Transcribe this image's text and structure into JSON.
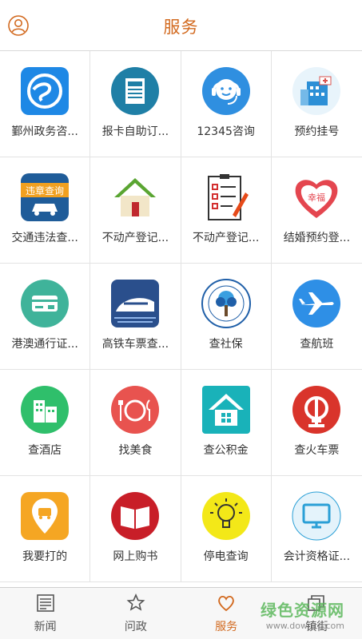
{
  "header": {
    "title": "服务",
    "profile_icon": "user-profile-icon",
    "accent": "#d2691e"
  },
  "grid": [
    [
      {
        "label": "鄞州政务咨...",
        "icon": "yinzhou-government-icon"
      },
      {
        "label": "报卡自助订...",
        "icon": "newspaper-icon"
      },
      {
        "label": "12345咨询",
        "icon": "customer-service-icon"
      },
      {
        "label": "预约挂号",
        "icon": "hospital-icon"
      }
    ],
    [
      {
        "label": "交通违法查...",
        "icon": "traffic-violation-icon",
        "badge": "违章查询"
      },
      {
        "label": "不动产登记...",
        "icon": "house-icon"
      },
      {
        "label": "不动产登记...",
        "icon": "checklist-icon"
      },
      {
        "label": "结婚预约登...",
        "icon": "wedding-heart-icon",
        "badge": "幸福"
      }
    ],
    [
      {
        "label": "港澳通行证...",
        "icon": "travel-permit-card-icon"
      },
      {
        "label": "高铁车票查...",
        "icon": "high-speed-train-icon"
      },
      {
        "label": "查社保",
        "icon": "social-security-icon"
      },
      {
        "label": "查航班",
        "icon": "airplane-icon"
      }
    ],
    [
      {
        "label": "查酒店",
        "icon": "hotel-icon"
      },
      {
        "label": "找美食",
        "icon": "food-plate-icon"
      },
      {
        "label": "查公积金",
        "icon": "housing-fund-icon"
      },
      {
        "label": "查火车票",
        "icon": "railway-icon"
      }
    ],
    [
      {
        "label": "我要打的",
        "icon": "taxi-icon"
      },
      {
        "label": "网上购书",
        "icon": "book-icon"
      },
      {
        "label": "停电查询",
        "icon": "lightbulb-icon"
      },
      {
        "label": "会计资格证...",
        "icon": "computer-monitor-icon"
      }
    ]
  ],
  "tabbar": [
    {
      "label": "新闻",
      "icon": "news-icon",
      "active": false
    },
    {
      "label": "问政",
      "icon": "star-icon",
      "active": false
    },
    {
      "label": "服务",
      "icon": "heart-icon",
      "active": true
    },
    {
      "label": "镇街",
      "icon": "layers-icon",
      "active": false
    }
  ],
  "watermark": {
    "line1": "绿色资源网",
    "line2": "www.downcc.com"
  }
}
